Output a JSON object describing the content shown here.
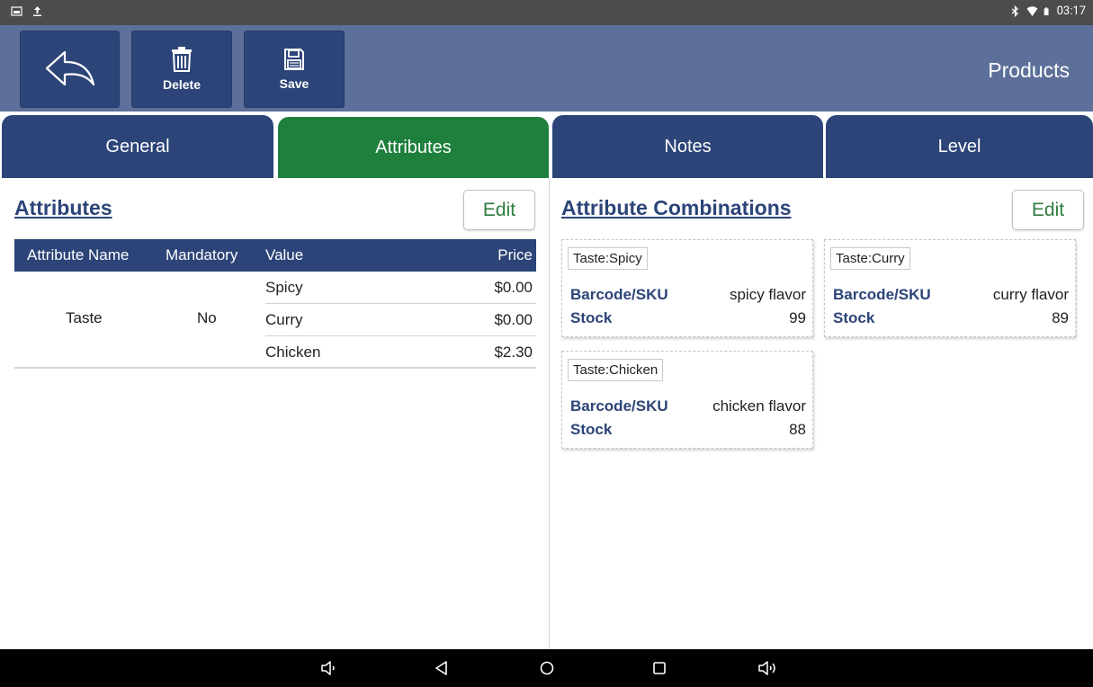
{
  "status_bar": {
    "time": "03:17"
  },
  "app_bar": {
    "title": "Products",
    "delete_label": "Delete",
    "save_label": "Save"
  },
  "tabs": [
    {
      "label": "General",
      "active": false
    },
    {
      "label": "Attributes",
      "active": true
    },
    {
      "label": "Notes",
      "active": false
    },
    {
      "label": "Level",
      "active": false
    }
  ],
  "attributes": {
    "title": "Attributes",
    "edit_label": "Edit",
    "columns": [
      "Attribute Name",
      "Mandatory",
      "Value",
      "Price"
    ],
    "rows": [
      {
        "name": "Taste",
        "mandatory": "No",
        "values": [
          {
            "value": "Spicy",
            "price": "$0.00"
          },
          {
            "value": "Curry",
            "price": "$0.00"
          },
          {
            "value": "Chicken",
            "price": "$2.30"
          }
        ]
      }
    ]
  },
  "combinations": {
    "title": "Attribute Combinations",
    "edit_label": "Edit",
    "barcode_label": "Barcode/SKU",
    "stock_label": "Stock",
    "items": [
      {
        "tag": "Taste:Spicy",
        "barcode": "spicy flavor",
        "stock": "99"
      },
      {
        "tag": "Taste:Curry",
        "barcode": "curry flavor",
        "stock": "89"
      },
      {
        "tag": "Taste:Chicken",
        "barcode": "chicken flavor",
        "stock": "88"
      }
    ]
  },
  "colors": {
    "app_bar": "#5d7099",
    "button_navy": "#2c4478",
    "tab_active": "#1f7f3d",
    "edit_text": "#2e7d3e"
  }
}
